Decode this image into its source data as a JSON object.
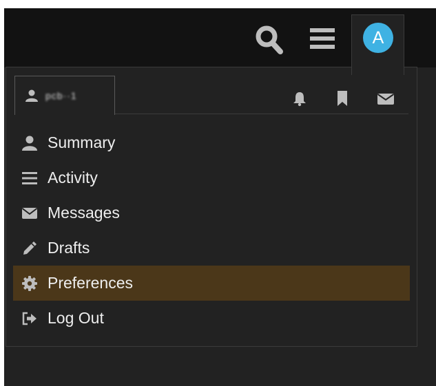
{
  "header": {
    "avatar_letter": "A",
    "icons": [
      "search-icon",
      "menu-icon"
    ]
  },
  "user_menu": {
    "username": "pcb··1",
    "quick_tabs": [
      "bell-icon",
      "bookmark-icon",
      "envelope-icon"
    ],
    "items": [
      {
        "label": "Summary",
        "icon": "person-icon"
      },
      {
        "label": "Activity",
        "icon": "list-icon"
      },
      {
        "label": "Messages",
        "icon": "envelope-icon"
      },
      {
        "label": "Drafts",
        "icon": "pencil-icon"
      },
      {
        "label": "Preferences",
        "icon": "gear-icon",
        "highlighted": true
      },
      {
        "label": "Log Out",
        "icon": "sign-out-icon"
      }
    ]
  },
  "colors": {
    "background": "#222222",
    "header_bar": "#121212",
    "avatar": "#3fb2e3",
    "highlight": "#4b3719",
    "icon": "#bdbdbd",
    "text": "#eeeeee"
  }
}
